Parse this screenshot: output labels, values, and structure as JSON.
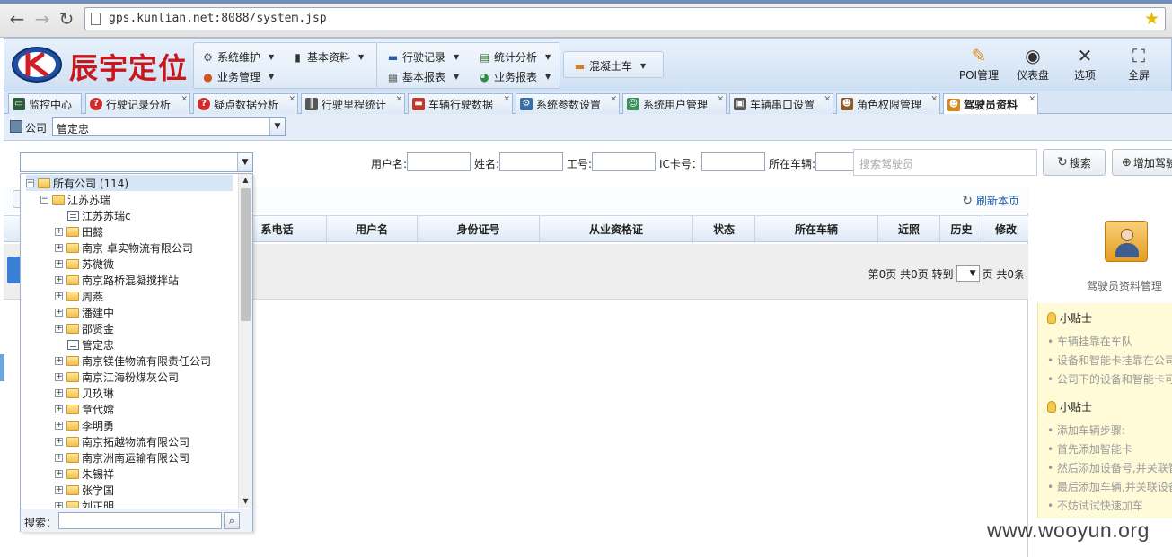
{
  "browser": {
    "url": "gps.kunlian.net:8088/system.jsp"
  },
  "app": {
    "logo_text": "辰宇定位",
    "menu_group1": [
      {
        "label": "系统维护",
        "icon": "gear-icon"
      },
      {
        "label": "基本资料",
        "icon": "chart-bars-icon"
      },
      {
        "label": "业务管理",
        "icon": "globe-icon"
      }
    ],
    "menu_group2": [
      {
        "label": "行驶记录",
        "icon": "truck-icon"
      },
      {
        "label": "统计分析",
        "icon": "chart-line-icon"
      },
      {
        "label": "基本报表",
        "icon": "report-icon"
      },
      {
        "label": "业务报表",
        "icon": "pie-chart-icon"
      }
    ],
    "menu_group3": [
      {
        "label": "混凝土车",
        "icon": "mixer-truck-icon"
      }
    ],
    "tools": [
      {
        "label": "POI管理",
        "icon": "pin-icon"
      },
      {
        "label": "仪表盘",
        "icon": "gauge-icon"
      },
      {
        "label": "选项",
        "icon": "tools-icon"
      },
      {
        "label": "全屏",
        "icon": "fullscreen-icon"
      }
    ]
  },
  "tabs": [
    {
      "label": "监控中心",
      "icon": "monitor-icon",
      "color": "#2e5b3a"
    },
    {
      "label": "行驶记录分析",
      "icon": "question-icon",
      "color": "#d22b2b"
    },
    {
      "label": "疑点数据分析",
      "icon": "question-icon",
      "color": "#d22b2b"
    },
    {
      "label": "行驶里程统计",
      "icon": "road-icon",
      "color": "#555555"
    },
    {
      "label": "车辆行驶数据",
      "icon": "car-icon",
      "color": "#c0392b"
    },
    {
      "label": "系统参数设置",
      "icon": "settings-icon",
      "color": "#3a6ea5"
    },
    {
      "label": "系统用户管理",
      "icon": "users-icon",
      "color": "#3a8f5a"
    },
    {
      "label": "车辆串口设置",
      "icon": "serial-icon",
      "color": "#555555"
    },
    {
      "label": "角色权限管理",
      "icon": "role-icon",
      "color": "#8a5a2b"
    },
    {
      "label": "驾驶员资料",
      "icon": "driver-icon",
      "color": "#d68a1c"
    }
  ],
  "company": {
    "label": "公司",
    "value": "管定忠"
  },
  "filters": {
    "username_label": "用户名:",
    "name_label": "姓名:",
    "job_no_label": "工号:",
    "ic_label": "IC卡号：",
    "vehicle_label": "所在车辆:",
    "search_placeholder": "搜索驾驶员",
    "search_button": "搜索",
    "add_button": "增加驾驶"
  },
  "grid": {
    "refresh": "刷新本页",
    "columns": [
      "系电话",
      "用户名",
      "身份证号",
      "从业资格证",
      "状态",
      "所在车辆",
      "近照",
      "历史",
      "修改"
    ],
    "pager": {
      "text_a": "第0页 共0页 转到",
      "text_b": "页 共0条"
    }
  },
  "tree": {
    "nodes": [
      {
        "label": "所有公司 (114)",
        "type": "folder",
        "expander": "−"
      },
      {
        "label": "江苏苏瑞",
        "type": "folder",
        "expander": "−"
      },
      {
        "label": "江苏苏瑞c",
        "type": "leaf",
        "expander": ""
      },
      {
        "label": "田懿",
        "type": "folder",
        "expander": "+"
      },
      {
        "label": "南京 卓实物流有限公司",
        "type": "folder",
        "expander": "+"
      },
      {
        "label": "苏微微",
        "type": "folder",
        "expander": "+"
      },
      {
        "label": "南京路桥混凝搅拌站",
        "type": "folder",
        "expander": "+"
      },
      {
        "label": "周燕",
        "type": "folder",
        "expander": "+"
      },
      {
        "label": "潘建中",
        "type": "folder",
        "expander": "+"
      },
      {
        "label": "邵贤金",
        "type": "folder",
        "expander": "+"
      },
      {
        "label": "管定忠",
        "type": "leaf",
        "expander": ""
      },
      {
        "label": "南京镁佳物流有限责任公司",
        "type": "folder",
        "expander": "+"
      },
      {
        "label": "南京江海粉煤灰公司",
        "type": "folder",
        "expander": "+"
      },
      {
        "label": "贝玖琳",
        "type": "folder",
        "expander": "+"
      },
      {
        "label": "章代嫦",
        "type": "folder",
        "expander": "+"
      },
      {
        "label": "李明勇",
        "type": "folder",
        "expander": "+"
      },
      {
        "label": "南京拓越物流有限公司",
        "type": "folder",
        "expander": "+"
      },
      {
        "label": "南京洲南运输有限公司",
        "type": "folder",
        "expander": "+"
      },
      {
        "label": "朱锡祥",
        "type": "folder",
        "expander": "+"
      },
      {
        "label": "张学国",
        "type": "folder",
        "expander": "+"
      },
      {
        "label": "刘正明",
        "type": "folder",
        "expander": "+"
      }
    ],
    "search_label": "搜索："
  },
  "side": {
    "caption": "驾驶员资料管理",
    "tips": [
      {
        "title": "小贴士",
        "lines": [
          "车辆挂靠在车队",
          "设备和智能卡挂靠在公司",
          "公司下的设备和智能卡可"
        ]
      },
      {
        "title": "小贴士",
        "lines": [
          "添加车辆步骤:",
          "首先添加智能卡",
          "然后添加设备号,并关联智",
          "最后添加车辆,并关联设备",
          "不妨试试快速加车"
        ]
      }
    ]
  },
  "watermark": "www.wooyun.org"
}
